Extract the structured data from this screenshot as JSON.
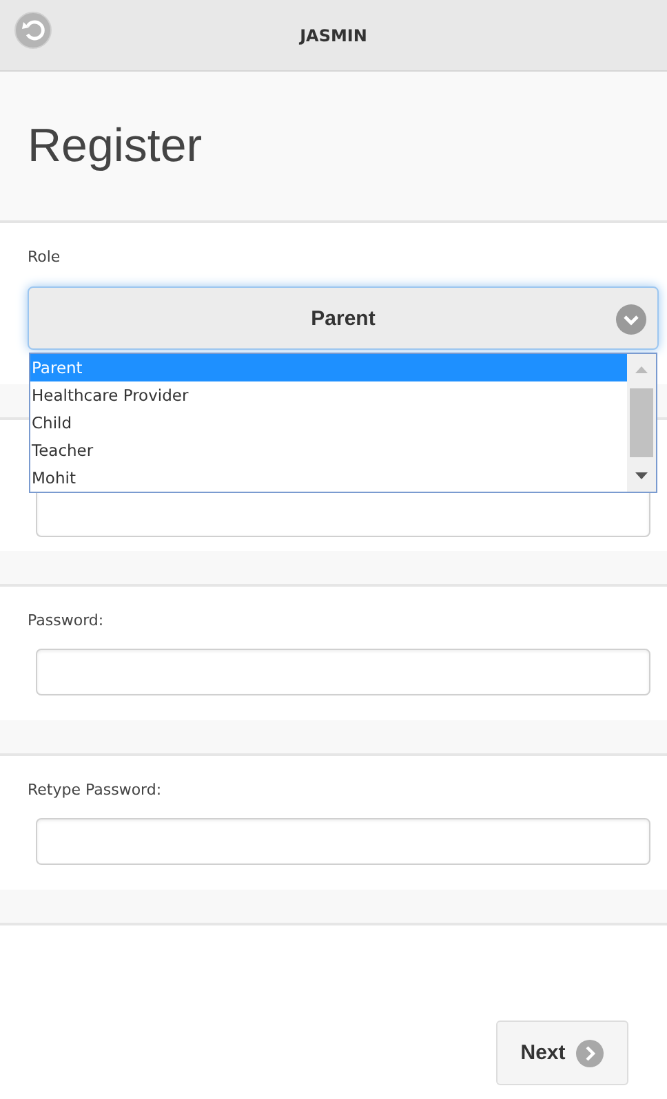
{
  "header": {
    "title": "JASMIN"
  },
  "page_title": "Register",
  "role": {
    "label": "Role",
    "value": "Parent",
    "expanded": true,
    "options": [
      {
        "label": "Parent",
        "selected": true
      },
      {
        "label": "Healthcare Provider",
        "selected": false
      },
      {
        "label": "Child",
        "selected": false
      },
      {
        "label": "Teacher",
        "selected": false
      },
      {
        "label": "Mohit",
        "selected": false
      }
    ]
  },
  "fields": [
    {
      "covered": true
    },
    {
      "covered": false,
      "label": "Password:"
    },
    {
      "covered": false,
      "label": "Retype Password:"
    }
  ],
  "next_button": "Next"
}
